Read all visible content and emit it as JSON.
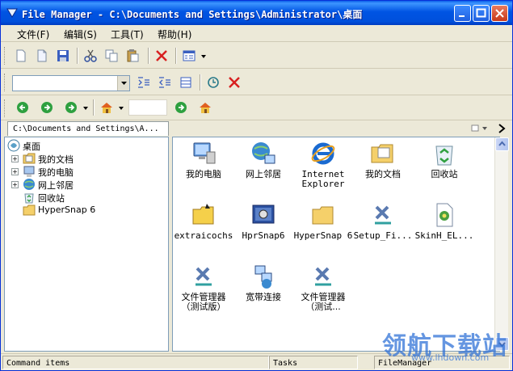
{
  "window": {
    "title": "File Manager - C:\\Documents and Settings\\Administrator\\桌面"
  },
  "menu": [
    {
      "label": "文件(F)"
    },
    {
      "label": "编辑(S)"
    },
    {
      "label": "工具(T)"
    },
    {
      "label": "帮助(H)"
    }
  ],
  "tabs": {
    "path": "C:\\Documents and Settings\\A..."
  },
  "tree": [
    {
      "label": "桌面",
      "icon": "desktop-icon"
    },
    {
      "label": "我的文档",
      "icon": "my-documents-icon"
    },
    {
      "label": "我的电脑",
      "icon": "my-computer-icon"
    },
    {
      "label": "网上邻居",
      "icon": "network-icon"
    },
    {
      "label": "回收站",
      "icon": "recycle-bin-icon"
    },
    {
      "label": "HyperSnap 6",
      "icon": "folder-icon"
    }
  ],
  "files": [
    {
      "label": "我的电脑",
      "icon": "my-computer-icon"
    },
    {
      "label": "网上邻居",
      "icon": "network-icon"
    },
    {
      "label": "Internet Explorer",
      "icon": "ie-icon"
    },
    {
      "label": "我的文档",
      "icon": "my-documents-icon"
    },
    {
      "label": "回收站",
      "icon": "recycle-bin-icon"
    },
    {
      "label": "extraicochs",
      "icon": "folder-icon"
    },
    {
      "label": "HprSnap6",
      "icon": "hypersnap-icon"
    },
    {
      "label": "HyperSnap 6",
      "icon": "folder-icon"
    },
    {
      "label": "Setup_Fi...",
      "icon": "setup-icon"
    },
    {
      "label": "SkinH_EL...",
      "icon": "skin-file-icon"
    },
    {
      "label": "文件管理器（测试版）",
      "icon": "setup-icon"
    },
    {
      "label": "宽带连接",
      "icon": "broadband-icon"
    },
    {
      "label": "文件管理器（测试...",
      "icon": "setup-icon"
    }
  ],
  "status": {
    "left": "Command items",
    "middle": "Tasks",
    "right": "FileManager"
  },
  "watermark": {
    "brand": "领航下载站",
    "url": "www.lhdown.com"
  }
}
